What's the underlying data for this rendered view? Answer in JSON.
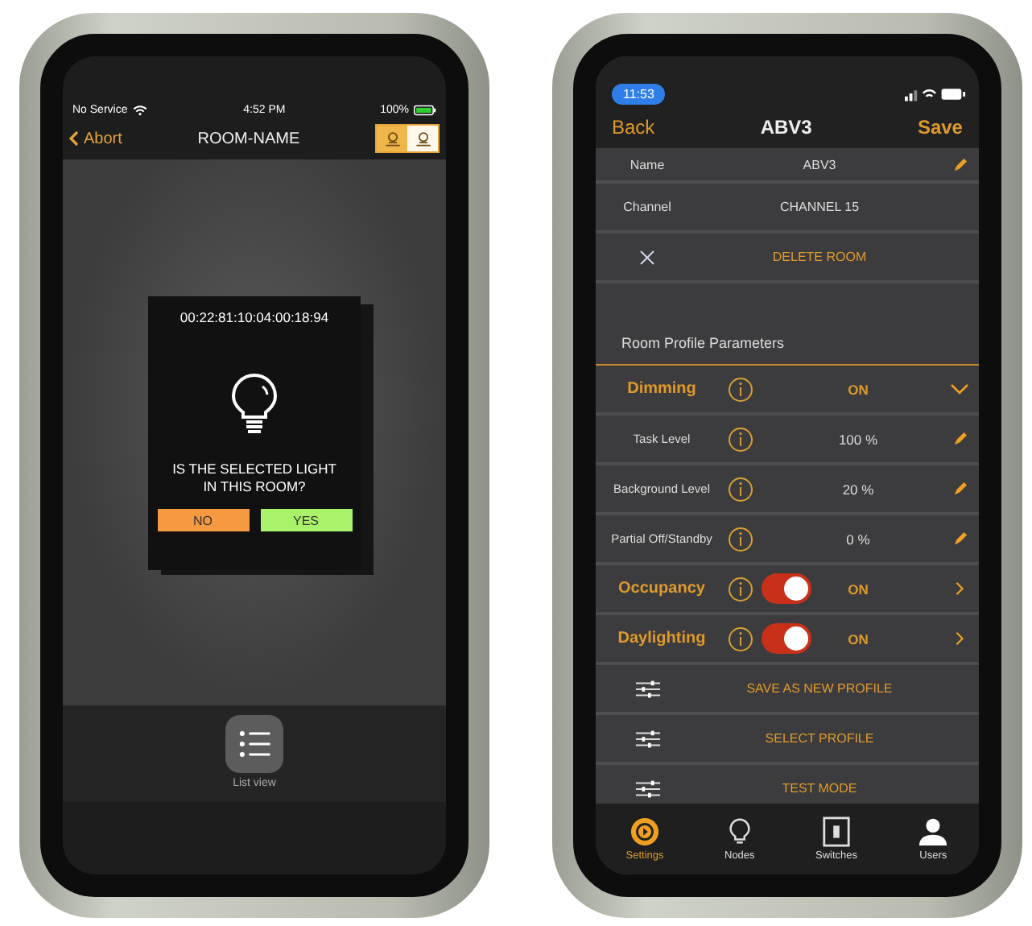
{
  "left_phone": {
    "status_bar": {
      "carrier": "No Service",
      "time": "4:52 PM",
      "battery": "100%"
    },
    "nav": {
      "back": "Abort",
      "title": "ROOM-NAME"
    },
    "mode_toggles": [
      {
        "selected": true
      },
      {
        "selected": false
      }
    ],
    "dialog": {
      "address": "00:22:81:10:04:00:18:94",
      "question": "IS THE SELECTED LIGHT IN THIS ROOM?",
      "buttons": [
        {
          "label": "NO",
          "kind": "no"
        },
        {
          "label": "YES",
          "kind": "yes"
        }
      ]
    },
    "bottom_bar": {
      "label": "List view"
    }
  },
  "right_phone": {
    "status_bar": {
      "time": "11:53"
    },
    "nav": {
      "back": "Back",
      "title": "ABV3",
      "action": "Save"
    },
    "info_rows": [
      {
        "label": "Name",
        "value": "ABV3",
        "editable": true
      },
      {
        "label": "Channel",
        "value": "CHANNEL 15",
        "editable": false
      }
    ],
    "delete_action": "DELETE ROOM",
    "section_title": "Room Profile Parameters",
    "params": [
      {
        "kind": "header",
        "label": "Dimming",
        "value": "ON",
        "expanded": true
      },
      {
        "kind": "level",
        "label": "Task Level",
        "value": "100 %"
      },
      {
        "kind": "level",
        "label": "Background Level",
        "value": "20 %"
      },
      {
        "kind": "level",
        "label": "Partial Off/Standby",
        "value": "0 %"
      },
      {
        "kind": "toggle",
        "label": "Occupancy",
        "value": "ON",
        "on": true
      },
      {
        "kind": "toggle",
        "label": "Daylighting",
        "value": "ON",
        "on": true
      }
    ],
    "actions": [
      "SAVE AS NEW PROFILE",
      "SELECT PROFILE",
      "TEST MODE"
    ],
    "tabs": [
      {
        "label": "Settings",
        "selected": true
      },
      {
        "label": "Nodes",
        "selected": false
      },
      {
        "label": "Switches",
        "selected": false
      },
      {
        "label": "Users",
        "selected": false
      }
    ]
  }
}
